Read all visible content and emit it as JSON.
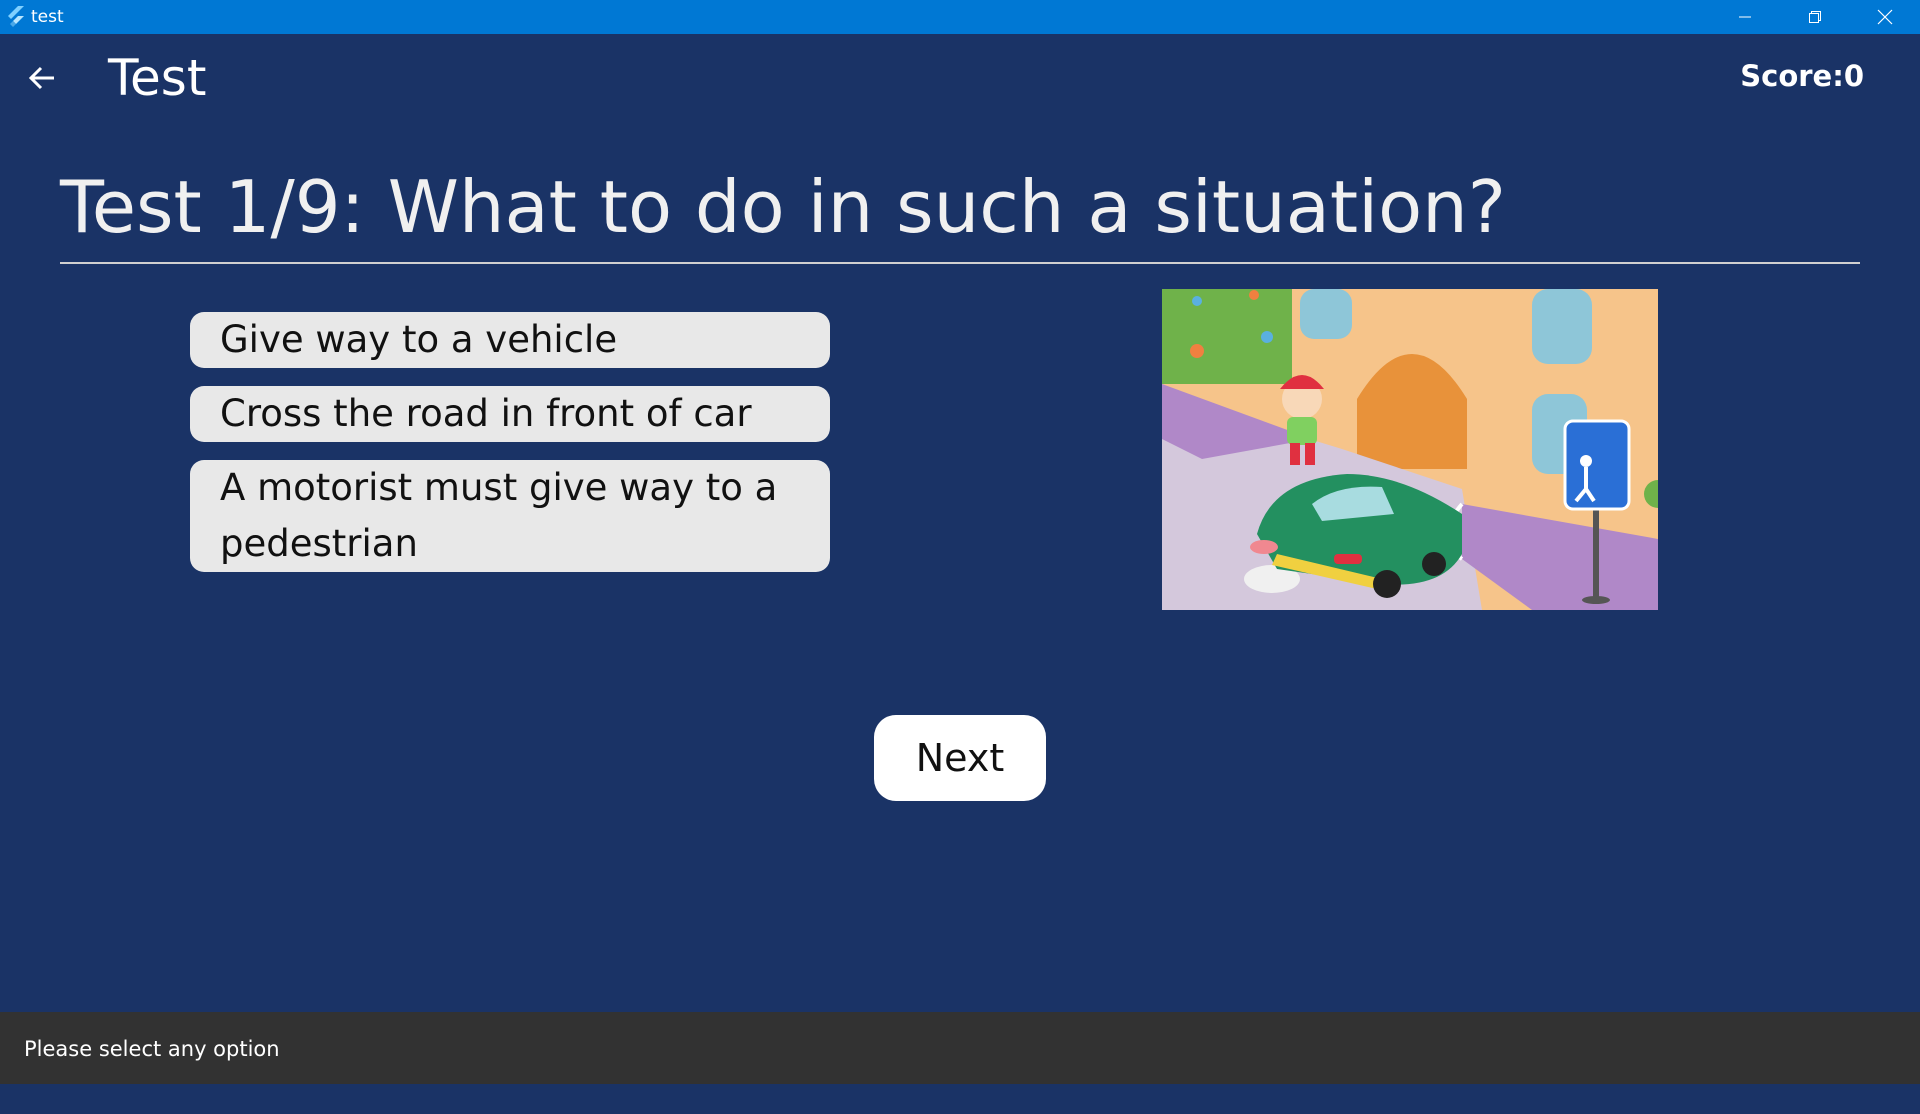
{
  "window": {
    "title": "test",
    "controls": [
      "minimize-icon",
      "restore-icon",
      "close-icon"
    ]
  },
  "appbar": {
    "back_icon": "arrow-back-icon",
    "title": "Test",
    "score": "Score:0"
  },
  "question": {
    "text": "Test 1/9: What to do in such a situation?"
  },
  "options": [
    {
      "label": "Give way to a vehicle"
    },
    {
      "label": "Cross the road in front of car"
    },
    {
      "label": "A motorist must give way to a pedestrian"
    }
  ],
  "illustration": {
    "icon": "street-crossing-illustration"
  },
  "actions": {
    "next_label": "Next"
  },
  "snackbar": {
    "message": "Please select any option"
  },
  "colors": {
    "background": "#1a3366",
    "titlebar": "#0078d4",
    "option_bg": "#e8e8e8",
    "snackbar_bg": "#323232"
  }
}
